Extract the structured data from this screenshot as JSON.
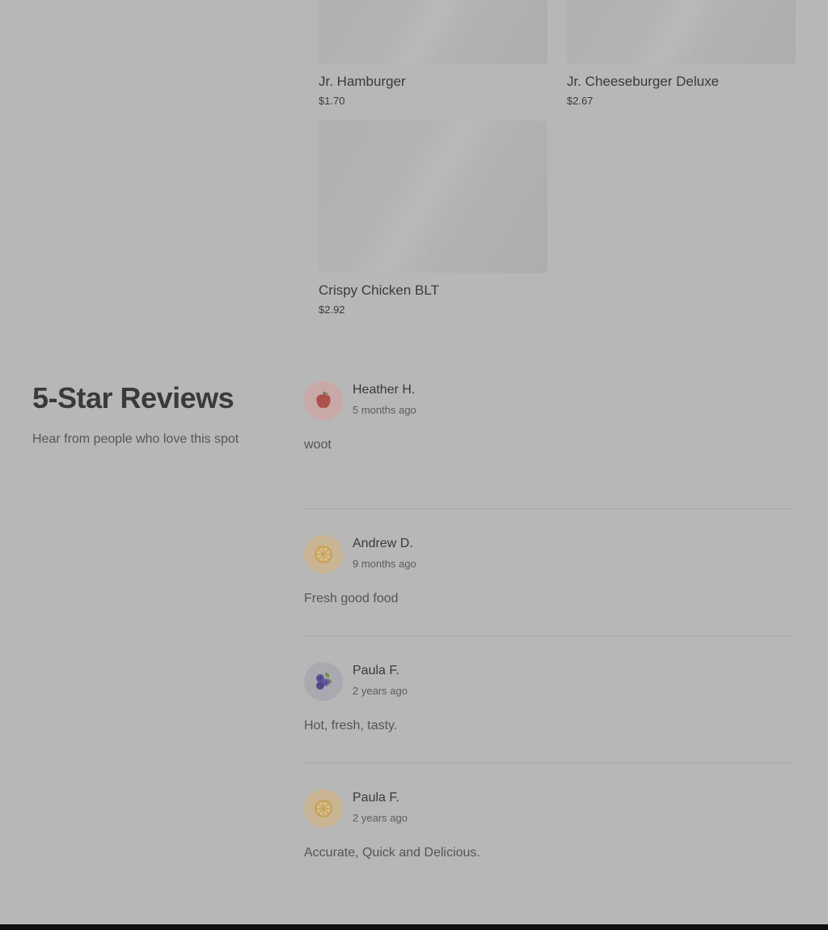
{
  "menu": {
    "items": [
      {
        "name": "Jr. Hamburger",
        "price": "$1.70"
      },
      {
        "name": "Jr. Cheeseburger Deluxe",
        "price": "$2.67"
      },
      {
        "name": "Crispy Chicken BLT",
        "price": "$2.92"
      }
    ]
  },
  "reviews": {
    "title": "5-Star Reviews",
    "subtitle": "Hear from people who love this spot",
    "items": [
      {
        "author": "Heather H.",
        "time": "5 months ago",
        "text": "woot",
        "avatar_icon": "apple-icon"
      },
      {
        "author": "Andrew D.",
        "time": "9 months ago",
        "text": "Fresh good food",
        "avatar_icon": "orange-slice-icon"
      },
      {
        "author": "Paula F.",
        "time": "2 years ago",
        "text": "Hot, fresh, tasty.",
        "avatar_icon": "blueberries-icon"
      },
      {
        "author": "Paula F.",
        "time": "2 years ago",
        "text": "Accurate, Quick and Delicious.",
        "avatar_icon": "orange-slice-icon"
      }
    ]
  },
  "colors": {
    "overlay_background": "#b7b7b7",
    "footer": "#0f0f0f"
  }
}
